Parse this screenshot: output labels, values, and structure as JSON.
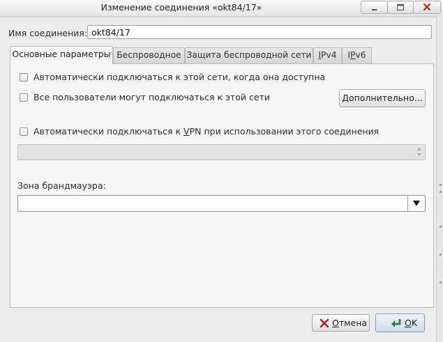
{
  "window": {
    "title": "Изменение соединения «okt84/17»"
  },
  "connection": {
    "name_label": "Имя соединения:",
    "name_value": "okt84/17"
  },
  "tabs": [
    {
      "label": "Основные параметры",
      "active": true
    },
    {
      "label": "Беспроводное",
      "active": false
    },
    {
      "label": "Защита беспроводной сети",
      "active": false
    },
    {
      "label_first": "I",
      "label_rest": "Pv4",
      "active": false
    },
    {
      "label_first": "I",
      "label_mid": "P",
      "label_rest": "v6",
      "active": false
    }
  ],
  "general": {
    "auto_connect_label": "Автоматически подключаться к этой сети, когда она доступна",
    "all_users_label": "Все пользователи могут подключаться к этой сети",
    "advanced_button": "Дополнительно...",
    "auto_vpn_before": "Автоматически подключаться к ",
    "auto_vpn_key": "V",
    "auto_vpn_after": "PN при использовании этого соединения",
    "firewall_zone_label": "Зона брандмауэра:"
  },
  "buttons": {
    "cancel_key": "О",
    "cancel_rest": "тмена",
    "ok_key": "О",
    "ok_rest": "K"
  },
  "colors": {
    "cancel_icon": "#b22222",
    "ok_icon": "#3f7f33"
  }
}
